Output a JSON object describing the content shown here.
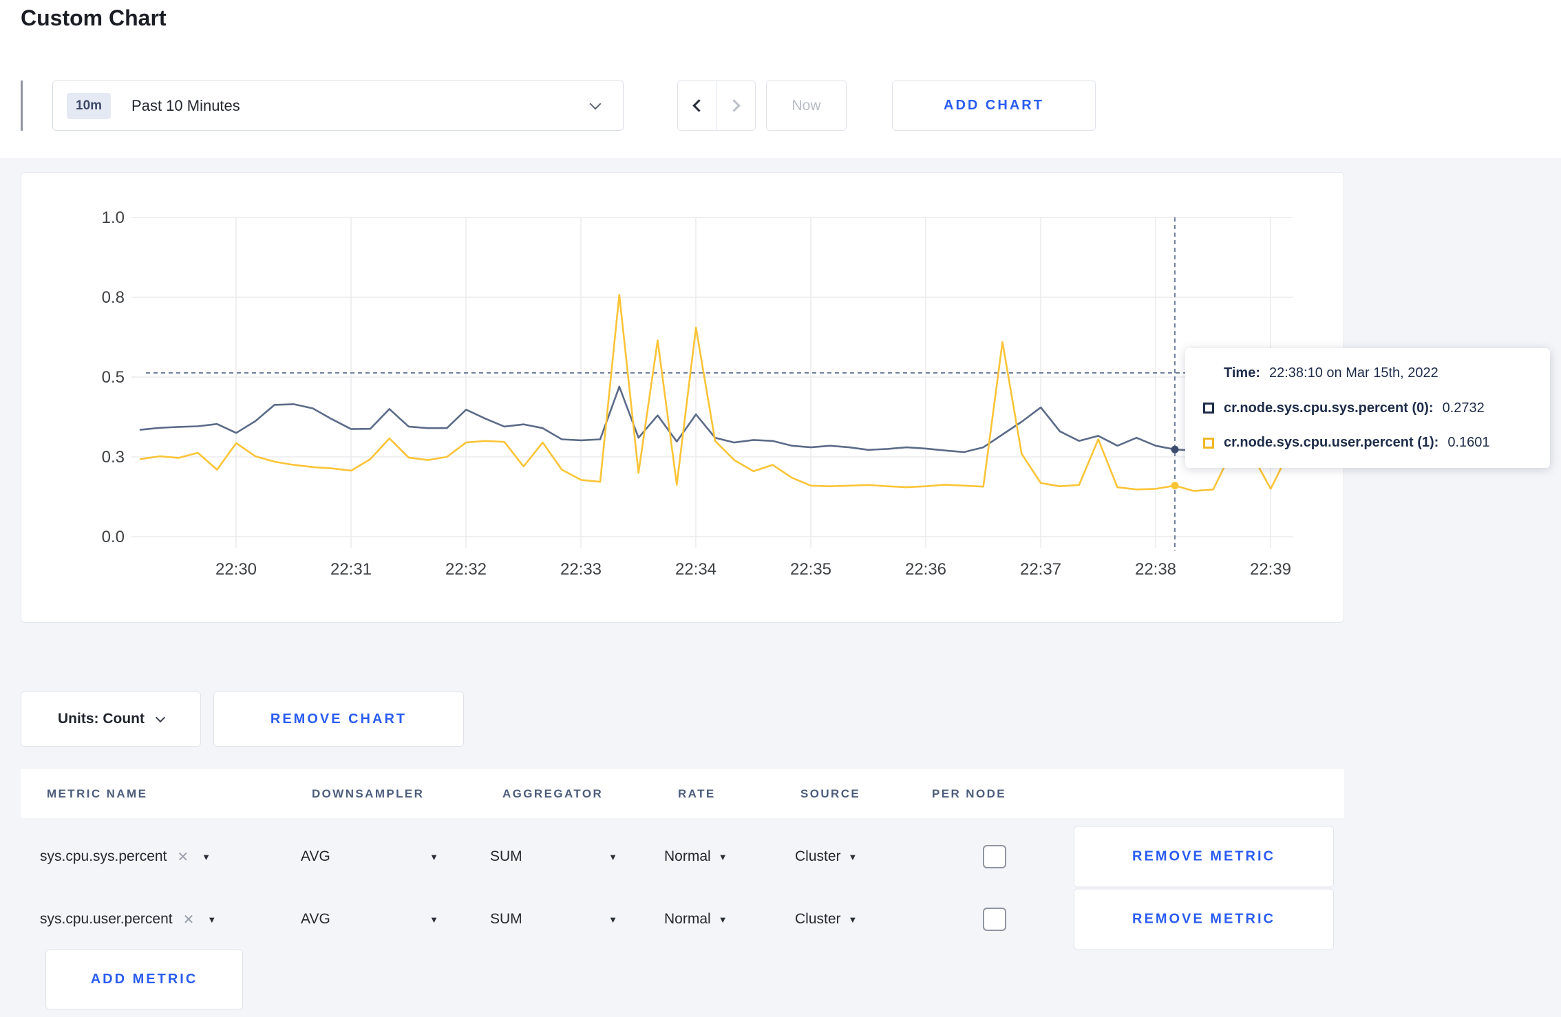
{
  "page": {
    "title": "Custom Chart"
  },
  "toolbar": {
    "time_window": {
      "badge": "10m",
      "label": "Past 10 Minutes"
    },
    "now_label": "Now",
    "add_chart_label": "ADD CHART"
  },
  "chart_controls": {
    "units_label": "Units: Count",
    "remove_chart_label": "REMOVE CHART",
    "remove_metric_label": "REMOVE METRIC",
    "add_metric_label": "ADD METRIC"
  },
  "icons": {
    "caret_down": "▼",
    "clear_x": "✕"
  },
  "metrics_table": {
    "columns": [
      "METRIC NAME",
      "DOWNSAMPLER",
      "AGGREGATOR",
      "RATE",
      "SOURCE",
      "PER NODE"
    ],
    "rows": [
      {
        "metric_name": "sys.cpu.sys.percent",
        "downsampler": "AVG",
        "aggregator": "SUM",
        "rate": "Normal",
        "source": "Cluster",
        "per_node_checked": false
      },
      {
        "metric_name": "sys.cpu.user.percent",
        "downsampler": "AVG",
        "aggregator": "SUM",
        "rate": "Normal",
        "source": "Cluster",
        "per_node_checked": false
      }
    ]
  },
  "tooltip": {
    "time_label": "Time:",
    "time_value": "22:38:10 on Mar 15th, 2022",
    "series": [
      {
        "name": "cr.node.sys.cpu.sys.percent (0):",
        "value": "0.2732",
        "swatch": "#1e2c49"
      },
      {
        "name": "cr.node.sys.cpu.user.percent (1):",
        "value": "0.1601",
        "swatch": "#f2b824"
      }
    ]
  },
  "chart_data": {
    "type": "line",
    "title": "Custom Chart",
    "xlabel": "",
    "ylabel": "",
    "x_start": "22:29:10",
    "x_step_seconds": 10,
    "x_tick_labels": [
      "22:30",
      "22:31",
      "22:32",
      "22:33",
      "22:34",
      "22:35",
      "22:36",
      "22:37",
      "22:38",
      "22:39"
    ],
    "y_tick_labels": [
      "0.0",
      "0.3",
      "0.5",
      "0.8",
      "1.0"
    ],
    "y_tick_values": [
      0,
      0.25,
      0.5,
      0.75,
      1
    ],
    "ylim": [
      0,
      1
    ],
    "grid": true,
    "legend_position": "tooltip",
    "crosshair": {
      "time": "22:38:10",
      "x_index": 54,
      "y_value": 0.513
    },
    "series": [
      {
        "name": "cr.node.sys.cpu.sys.percent (0)",
        "color": "#5b6b88",
        "dot_color": "#3c4c6e",
        "values": [
          0.335,
          0.341,
          0.344,
          0.346,
          0.353,
          0.325,
          0.362,
          0.413,
          0.415,
          0.402,
          0.368,
          0.337,
          0.338,
          0.4,
          0.345,
          0.34,
          0.34,
          0.398,
          0.37,
          0.345,
          0.352,
          0.34,
          0.305,
          0.302,
          0.305,
          0.47,
          0.31,
          0.38,
          0.298,
          0.383,
          0.31,
          0.295,
          0.303,
          0.3,
          0.285,
          0.28,
          0.285,
          0.28,
          0.272,
          0.275,
          0.28,
          0.276,
          0.27,
          0.265,
          0.28,
          0.32,
          0.36,
          0.405,
          0.33,
          0.3,
          0.316,
          0.285,
          0.31,
          0.285,
          0.2732,
          0.27,
          0.298,
          0.31,
          0.3,
          0.295,
          0.3
        ]
      },
      {
        "name": "cr.node.sys.cpu.user.percent (1)",
        "color": "#fbc437",
        "dot_color": "#fbc437",
        "values": [
          0.243,
          0.252,
          0.247,
          0.263,
          0.21,
          0.293,
          0.252,
          0.235,
          0.225,
          0.218,
          0.214,
          0.207,
          0.243,
          0.308,
          0.248,
          0.24,
          0.25,
          0.295,
          0.3,
          0.297,
          0.22,
          0.295,
          0.21,
          0.178,
          0.172,
          0.758,
          0.2,
          0.615,
          0.163,
          0.655,
          0.3,
          0.24,
          0.205,
          0.225,
          0.185,
          0.16,
          0.158,
          0.16,
          0.162,
          0.158,
          0.155,
          0.158,
          0.163,
          0.16,
          0.157,
          0.61,
          0.26,
          0.168,
          0.158,
          0.162,
          0.305,
          0.155,
          0.148,
          0.15,
          0.1601,
          0.143,
          0.148,
          0.27,
          0.26,
          0.15,
          0.27
        ]
      }
    ]
  }
}
